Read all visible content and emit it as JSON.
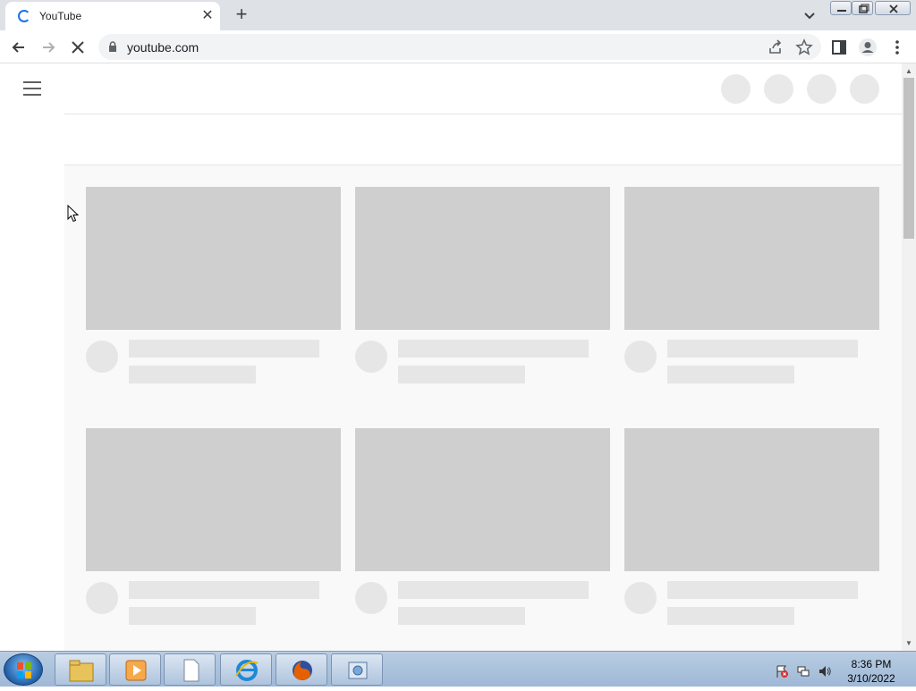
{
  "browser": {
    "tab": {
      "title": "YouTube",
      "close_glyph": "✕"
    },
    "new_tab_glyph": "+",
    "address": {
      "url": "youtube.com"
    }
  },
  "page": {
    "loading": true,
    "skeleton_cards": 6
  },
  "taskbar": {
    "items": [
      "windows-explorer",
      "media-player",
      "blank-document",
      "internet-explorer",
      "firefox",
      "app-window"
    ],
    "clock": {
      "time": "8:36 PM",
      "date": "3/10/2022"
    }
  },
  "colors": {
    "accent": "#1a73e8",
    "skeleton_thumb": "#cfcfcf",
    "skeleton_text": "#e6e6e6"
  }
}
